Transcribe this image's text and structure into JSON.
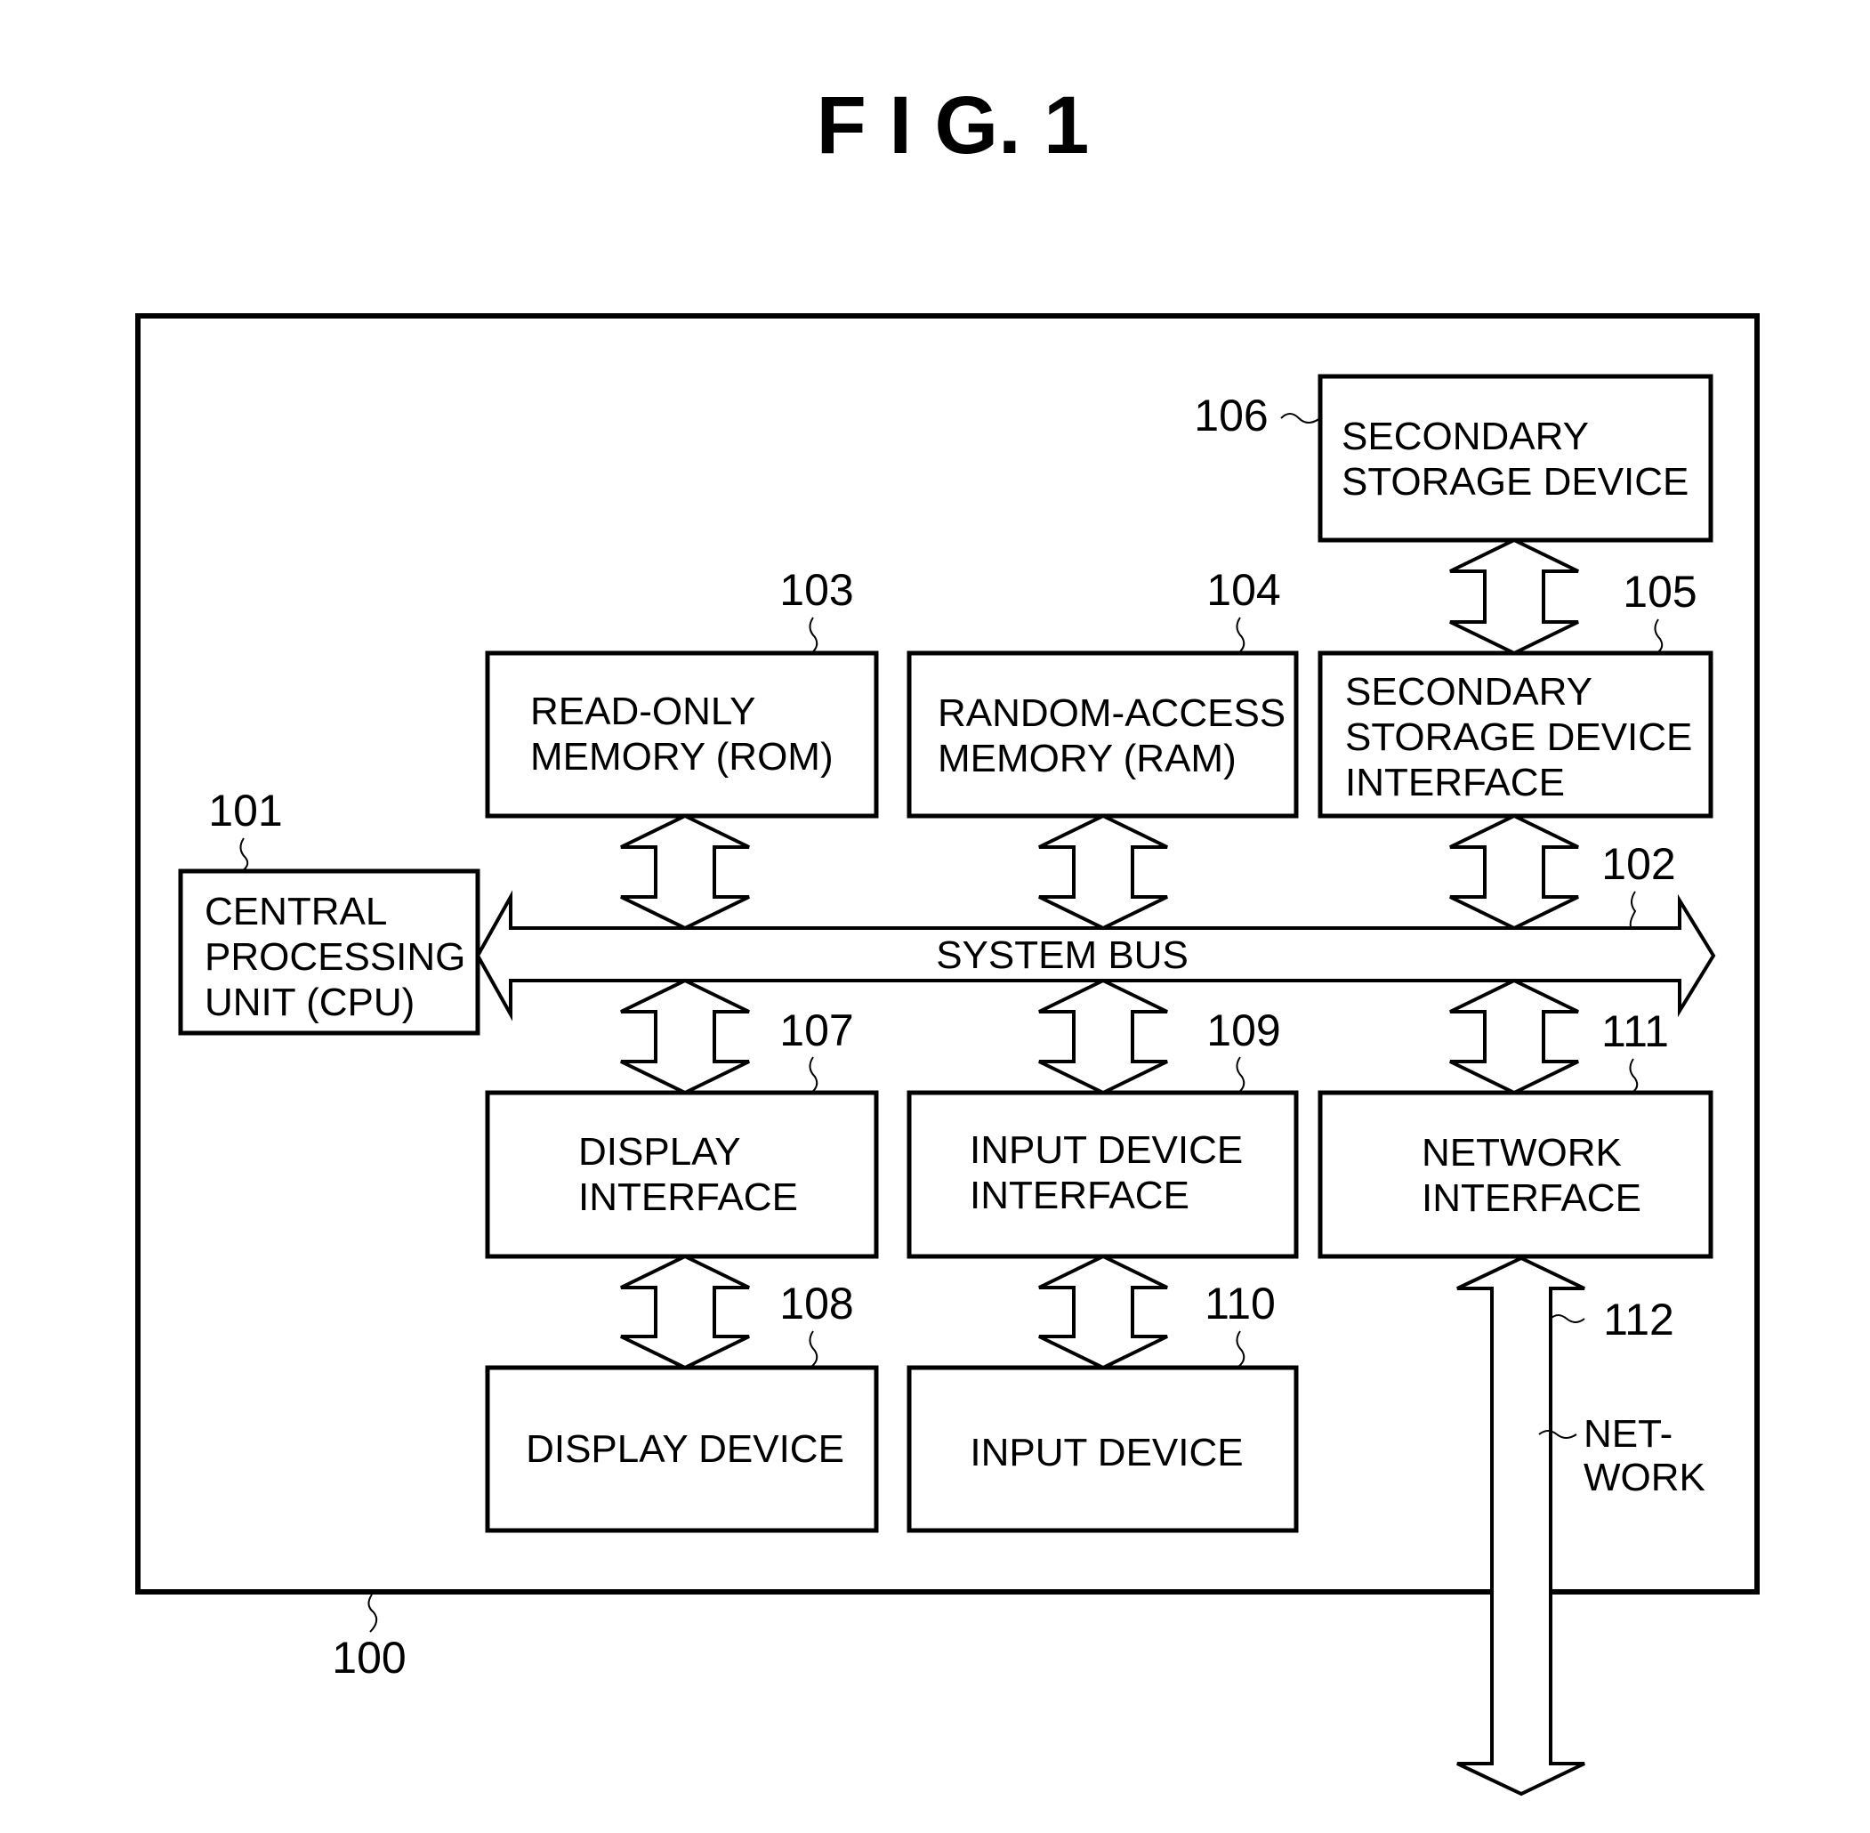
{
  "figure": {
    "title": "F I G.  1"
  },
  "system": {
    "ref": "100"
  },
  "bus": {
    "ref": "102",
    "label": "SYSTEM BUS"
  },
  "components": {
    "cpu": {
      "ref": "101",
      "lines": [
        "CENTRAL",
        "PROCESSING",
        "UNIT  (CPU)"
      ]
    },
    "rom": {
      "ref": "103",
      "lines": [
        "READ-ONLY",
        "MEMORY  (ROM)"
      ]
    },
    "ram": {
      "ref": "104",
      "lines": [
        "RANDOM-ACCESS",
        "MEMORY  (RAM)"
      ]
    },
    "ssd_interface": {
      "ref": "105",
      "lines": [
        "SECONDARY",
        "STORAGE  DEVICE",
        "INTERFACE"
      ]
    },
    "ssd": {
      "ref": "106",
      "lines": [
        "SECONDARY",
        "STORAGE  DEVICE"
      ]
    },
    "display_interface": {
      "ref": "107",
      "lines": [
        "DISPLAY",
        "INTERFACE"
      ]
    },
    "display_device": {
      "ref": "108",
      "lines": [
        "DISPLAY  DEVICE"
      ]
    },
    "input_interface": {
      "ref": "109",
      "lines": [
        "INPUT  DEVICE",
        "INTERFACE"
      ]
    },
    "input_device": {
      "ref": "110",
      "lines": [
        "INPUT  DEVICE"
      ]
    },
    "network_interface": {
      "ref": "111",
      "lines": [
        "NETWORK",
        "INTERFACE"
      ]
    }
  },
  "network": {
    "ref": "112",
    "lines": [
      "NET-",
      "WORK"
    ]
  }
}
